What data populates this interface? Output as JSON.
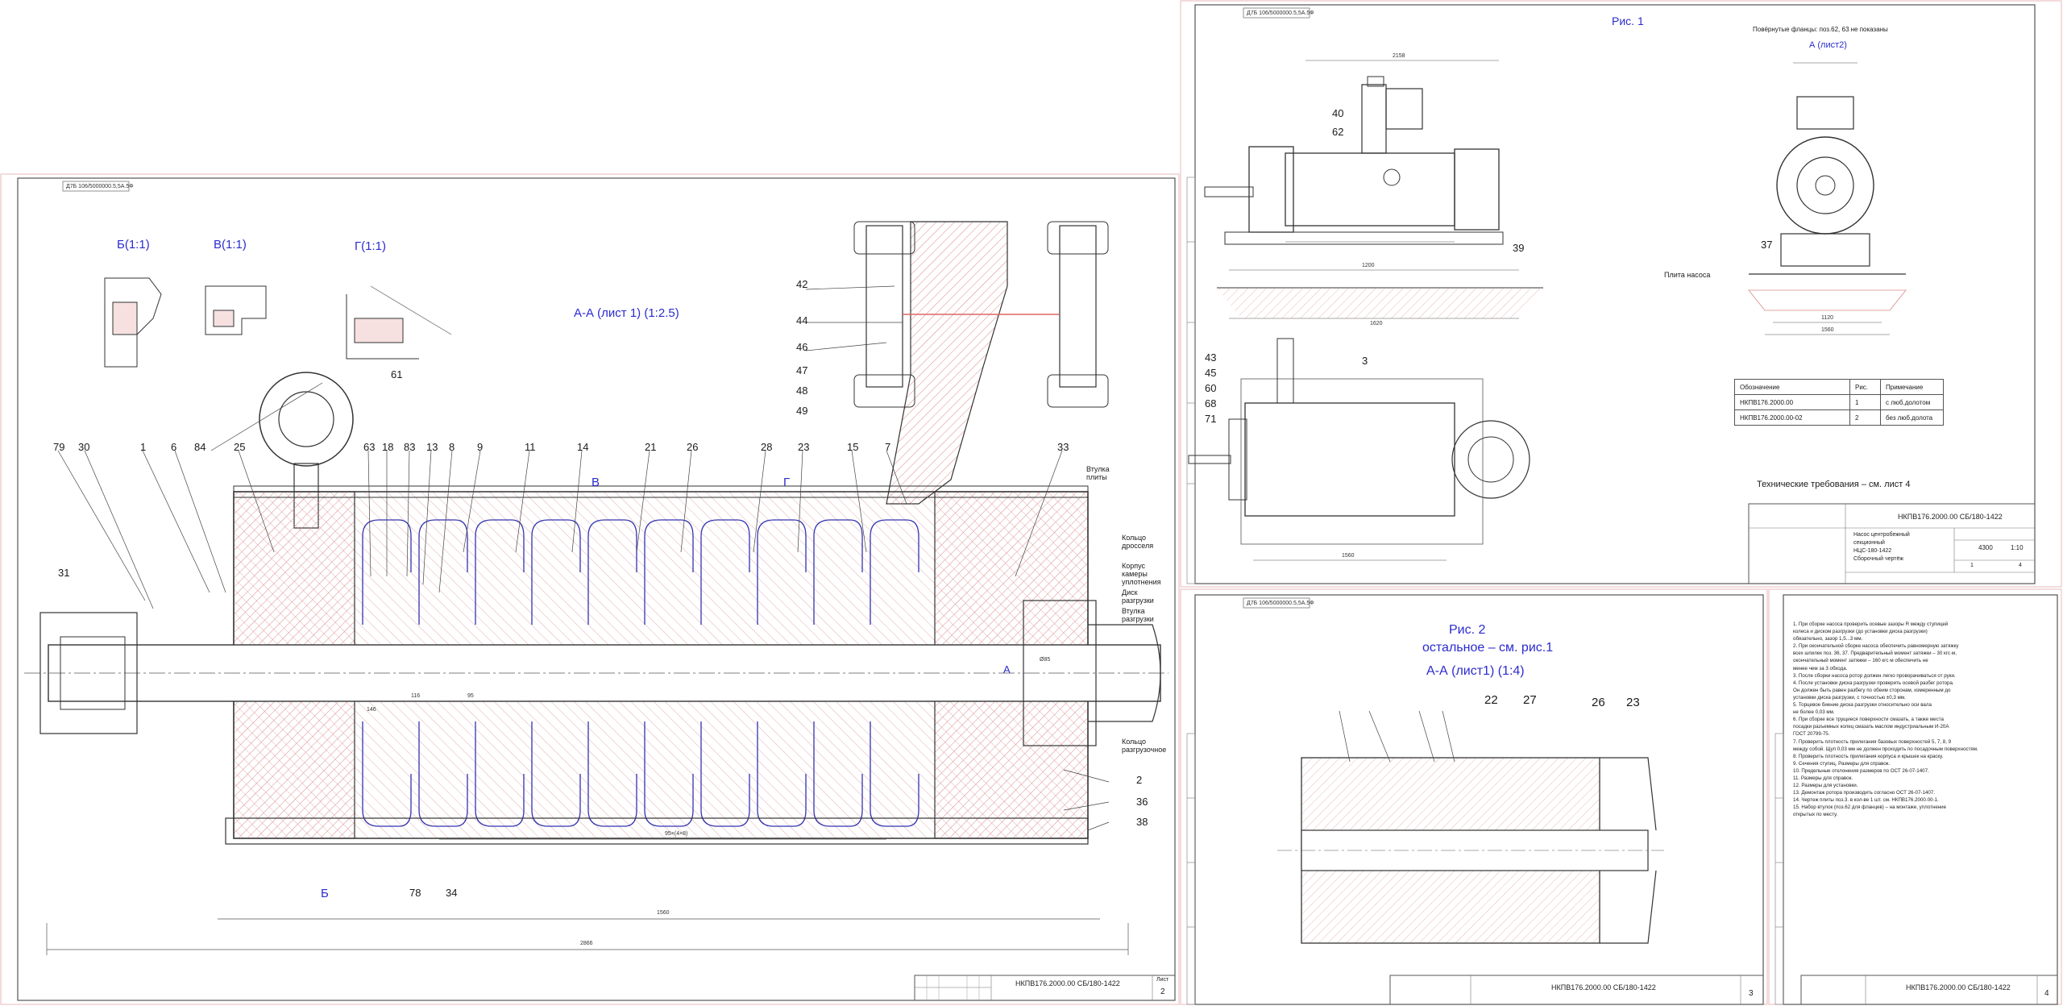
{
  "sheet1": {
    "top_stamp": "Д7Б 106/5000000.5,5А.5Ф",
    "sections": [
      "Б(1:1)",
      "В(1:1)",
      "Г(1:1)"
    ],
    "main_section": "А-А (лист 1) (1:2.5)",
    "section_letters": [
      "В",
      "Г",
      "А",
      "Б"
    ],
    "part_numbers_top": [
      "79",
      "30",
      "1",
      "6",
      "84",
      "25",
      "63",
      "18",
      "83",
      "13",
      "8",
      "9",
      "11",
      "14",
      "21",
      "26",
      "28",
      "23",
      "15",
      "7",
      "33"
    ],
    "part_numbers_right": [
      "42",
      "44",
      "46",
      "47",
      "48",
      "49"
    ],
    "part_numbers_bottom": [
      "31",
      "78",
      "34",
      "2",
      "36",
      "38",
      "61"
    ],
    "callouts": [
      "Втулка плиты",
      "Кольцо дросселя",
      "Корпус камеры уплотнения",
      "Диск разгрузки",
      "Втулка разгрузки",
      "Кольцо разгрузочное"
    ],
    "dimensions": [
      "1560",
      "2866",
      "95×(4×8)",
      "116",
      "95",
      "146",
      "Ø85"
    ],
    "title_block": {
      "doc": "НКПВ176.2000.00 СБ/180-1422",
      "sheet_label": "Лист",
      "sheet_no": "2"
    }
  },
  "sheet2": {
    "top_stamp": "Д7Б 106/5000000.5,5А.5Ф",
    "fig_label": "Рис. 1",
    "view_label": "Повёрнутые фланцы: поз.62, 63 не показаны",
    "view_a": "А (лист2)",
    "part_numbers": [
      "40",
      "62",
      "39",
      "37",
      "3",
      "43",
      "45",
      "60",
      "68",
      "71"
    ],
    "plate_label": "Плита насоса",
    "dimensions": [
      "2158",
      "1200",
      "1620",
      "1560",
      "1120",
      "1560"
    ],
    "table": {
      "headers": [
        "Обозначение",
        "Рис.",
        "Примечание"
      ],
      "rows": [
        [
          "НКПВ176.2000.00",
          "1",
          "с люб.долотом"
        ],
        [
          "НКПВ176.2000.00-02",
          "2",
          "без люб.долота"
        ]
      ]
    },
    "tech_requirements": "Технические требования – см. лист 4",
    "title_block": {
      "doc": "НКПВ176.2000.00 СБ/180-1422",
      "name_lines": [
        "Насос центробежный",
        "секционный",
        "НЦС-180-1422",
        "Сборочный чертёж"
      ],
      "mass": "4300",
      "scale": "1:10",
      "sheet": "1",
      "sheets": "4"
    }
  },
  "sheet3": {
    "top_stamp": "Д7Б 106/5000000.5,5А.5Ф",
    "fig_label": "Рис. 2",
    "rest_label": "остальное – см. рис.1",
    "section_label": "А-А (лист1) (1:4)",
    "part_numbers": [
      "22",
      "27",
      "26",
      "23"
    ],
    "title_block": {
      "doc": "НКПВ176.2000.00 СБ/180-1422",
      "sheet_no": "3"
    }
  },
  "sheet4": {
    "notes": [
      "1. При сборке насоса проверить осевые зазоры R между ступицей",
      "   колеса и диском разгрузки (до установки диска разгрузки)",
      "   обязательно, зазор 1,5...3 мм.",
      "2. При окончательной сборке насоса обеспечить равномерную затяжку",
      "   всех шпилек поз. 36, 37. Предварительный момент затяжки – 30 кгс·м,",
      "   окончательный момент затяжки – 160 кгс·м обеспечить не",
      "   менее чем за 3 обхода.",
      "3. После сборки насоса ротор должен легко проворачиваться от руки.",
      "4. После установки диска разгрузки проверить осевой разбег ротора.",
      "   Он должен быть равен разбегу по обеим сторонам, измеренным до",
      "   установки диска разгрузки, с точностью ±0,3 мм.",
      "5. Торцевое биение диска разгрузки относительно оси вала",
      "   не более 0,03 мм.",
      "6. При сборке все трущиеся поверхности смазать, а также места",
      "   посадки разъемных колец смазать маслом индустриальным И-20А",
      "   ГОСТ 20799-75.",
      "7. Проверить плотность прилегания базовых поверхностей 5, 7, 8, 9",
      "   между собой. Щуп 0,03 мм не должен проходить по посадочным поверхностям.",
      "8. Проверить плотность прилегания корпуса и крышек на краску.",
      "9. Сечения ступиц. Размеры для справок.",
      "10. Предельные отклонения размеров по ОСТ 26-07-1407.",
      "11. Размеры для справок.",
      "12. Размеры для установки.",
      "13. Демонтаж ротора производить согласно ОСТ 26-07-1407.",
      "14. Чертеж плиты поз.3. в кол-ве 1 шт. см. НКПВ176.2000.00-1.",
      "15. Набор втулок (поз.62 для фланцев) – на монтаже, уплотнение",
      "    открытых по месту."
    ],
    "title_block": {
      "doc": "НКПВ176.2000.00 СБ/180-1422",
      "sheet_no": "4"
    }
  },
  "colors": {
    "line": "#3a3a3a",
    "hatch": "#d66a6a",
    "frame": "#d9a0a0",
    "label": "#2b2bd0"
  }
}
